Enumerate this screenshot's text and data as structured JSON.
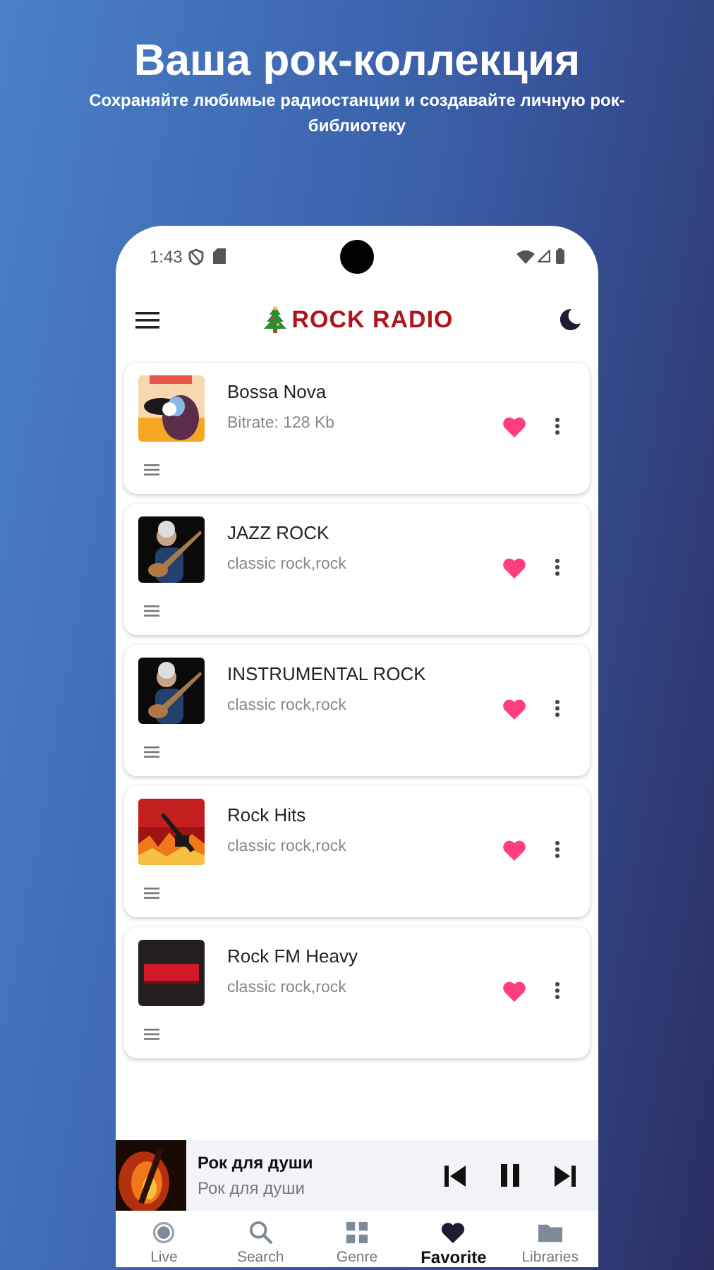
{
  "promo": {
    "title": "Ваша рок-коллекция",
    "subtitle": "Сохраняйте любимые радиостанции и создавайте личную рок-библиотеку"
  },
  "status_bar": {
    "time": "1:43"
  },
  "app_bar": {
    "title": "ROCK RADIO"
  },
  "stations": [
    {
      "name": "Bossa Nova",
      "info": "Bitrate: 128 Kb",
      "favorite": true
    },
    {
      "name": "JAZZ ROCK",
      "info": "classic rock,rock",
      "favorite": true
    },
    {
      "name": "INSTRUMENTAL ROCK",
      "info": "classic rock,rock",
      "favorite": true
    },
    {
      "name": "Rock Hits",
      "info": "classic rock,rock",
      "favorite": true
    },
    {
      "name": "Rock FM Heavy",
      "info": "classic rock,rock",
      "favorite": true
    }
  ],
  "player": {
    "title": "Рок для души",
    "subtitle": "Рок для души",
    "playing": true
  },
  "nav": [
    {
      "label": "Live",
      "selected": false
    },
    {
      "label": "Search",
      "selected": false
    },
    {
      "label": "Genre",
      "selected": false
    },
    {
      "label": "Favorite",
      "selected": true
    },
    {
      "label": "Libraries",
      "selected": false
    }
  ]
}
